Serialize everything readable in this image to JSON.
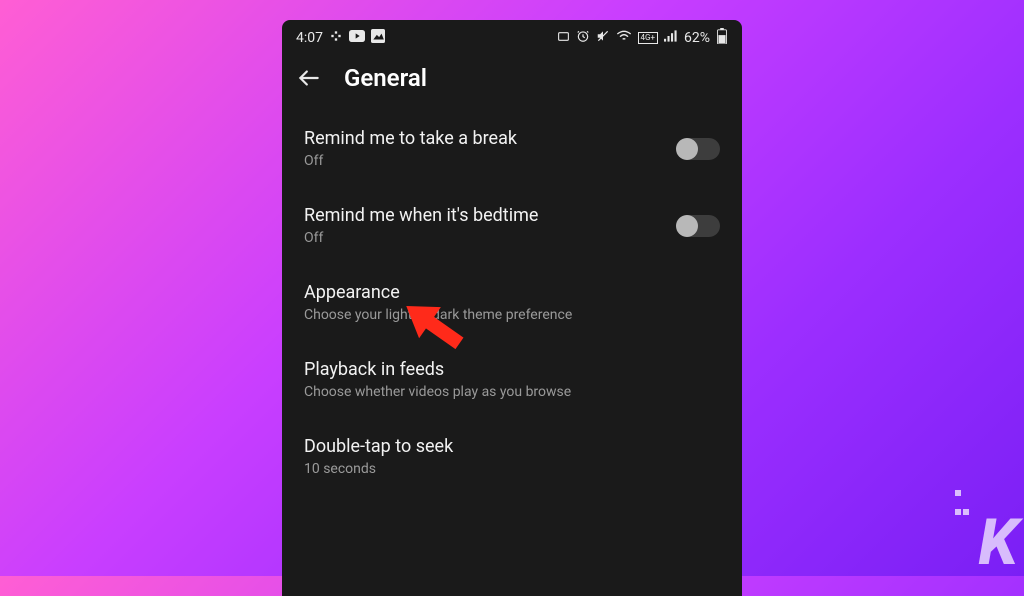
{
  "status": {
    "time": "4:07",
    "battery": "62%"
  },
  "header": {
    "title": "General"
  },
  "settings": [
    {
      "title": "Remind me to take a break",
      "sub": "Off",
      "toggle": true
    },
    {
      "title": "Remind me when it's bedtime",
      "sub": "Off",
      "toggle": true
    },
    {
      "title": "Appearance",
      "sub": "Choose your light or dark theme preference",
      "toggle": false
    },
    {
      "title": "Playback in feeds",
      "sub": "Choose whether videos play as you browse",
      "toggle": false
    },
    {
      "title": "Double-tap to seek",
      "sub": "10 seconds",
      "toggle": false
    }
  ],
  "annotation": {
    "color": "#ff2a1a"
  },
  "watermark": {
    "letter": "K"
  }
}
